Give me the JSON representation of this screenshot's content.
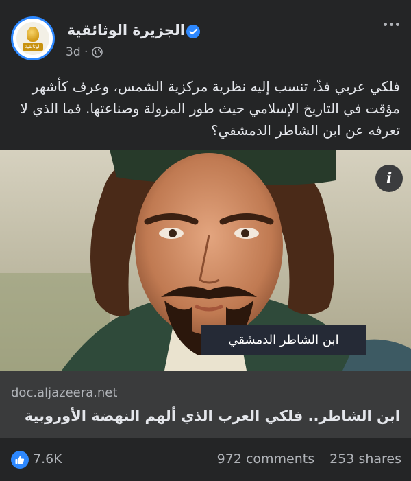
{
  "post": {
    "page_name": "الجزيرة  الوثائقية",
    "avatar_badge": "الوثائقية",
    "time": "3d ·",
    "caption": "فلكي عربي فذّ، تنسب إليه نظرية مركزية الشمس، وعرف كأشهر مؤقت في التاريخ الإسلامي حيث طور المزولة وصناعتها. فما الذي لا تعرفه عن ابن الشاطر الدمشقي؟",
    "image_overlay_label": "ابن الشاطر الدمشقي",
    "info_glyph": "i"
  },
  "link_preview": {
    "domain": "doc.aljazeera.net",
    "title": "ابن الشاطر.. فلكي العرب الذي ألهم النهضة الأوروبية"
  },
  "engagement": {
    "likes": "7.6K",
    "comments": "972 comments",
    "shares": "253 shares"
  },
  "colors": {
    "background": "#242526",
    "link_box": "#3a3b3c",
    "accent": "#2d88ff",
    "text_primary": "#e4e6eb",
    "text_secondary": "#b0b3b8"
  },
  "icons": [
    "verified-badge-icon",
    "globe-icon",
    "more-options-icon",
    "info-icon",
    "like-icon"
  ]
}
